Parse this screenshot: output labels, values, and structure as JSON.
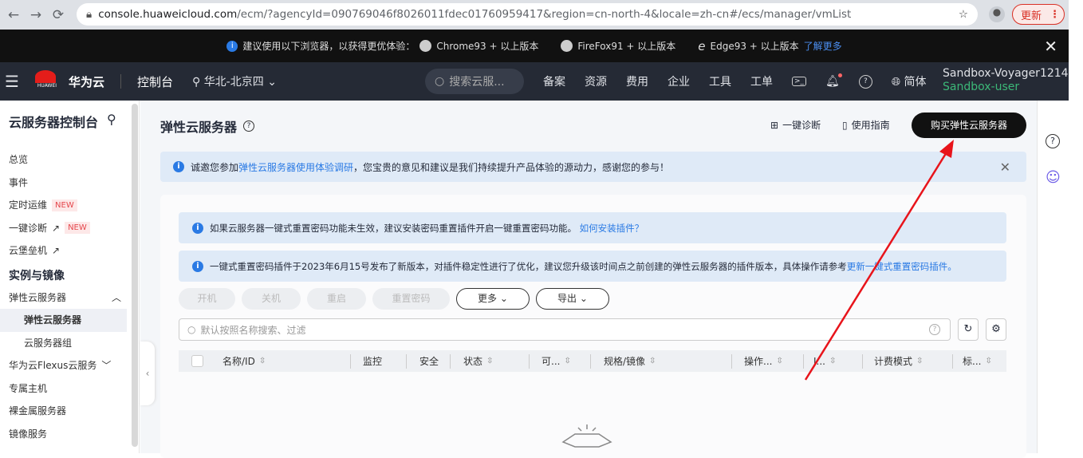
{
  "browser": {
    "url_host": "console.huaweicloud.com",
    "url_rest": "/ecm/?agencyId=090769046f8026011fdec01760959417&region=cn-north-4&locale=zh-cn#/ecs/manager/vmList",
    "update": "更新"
  },
  "banner": {
    "text": "建议使用以下浏览器，以获得更优体验：",
    "chrome": "Chrome93 + 以上版本",
    "firefox": "FireFox91 + 以上版本",
    "edge": "Edge93 + 以上版本",
    "more": "了解更多"
  },
  "topbar": {
    "brand": "华为云",
    "logo_text": "HUAWEI",
    "console": "控制台",
    "region": "华北-北京四",
    "search": "搜索云服...",
    "nav": [
      "备案",
      "资源",
      "费用",
      "企业",
      "工具",
      "工单"
    ],
    "lang": "简体",
    "account": "Sandbox-Voyager1214",
    "user": "Sandbox-user"
  },
  "sidebar": {
    "title": "云服务器控制台",
    "items": [
      "总览",
      "事件",
      "定时运维",
      "一键诊断",
      "云堡垒机"
    ],
    "new_badge": "NEW",
    "section": "实例与镜像",
    "group": "弹性云服务器",
    "sub": [
      "弹性云服务器",
      "云服务器组"
    ],
    "more": [
      "华为云Flexus云服务",
      "专属主机",
      "裸金属服务器",
      "镜像服务"
    ]
  },
  "main": {
    "title": "弹性云服务器",
    "diagnose": "一键诊断",
    "guide": "使用指南",
    "buy": "购买弹性云服务器",
    "notice_pre": "诚邀您参加",
    "notice_link": "弹性云服务器使用体验调研",
    "notice_post": "，您宝贵的意见和建议是我们持续提升产品体验的源动力，感谢您的参与！",
    "tip1": "如果云服务器一键式重置密码功能未生效，建议安装密码重置插件开启一键重置密码功能。",
    "tip1_link": "如何安装插件？",
    "tip2": "一键式重置密码插件于2023年6月15号发布了新版本，对插件稳定性进行了优化，建议您升级该时间点之前创建的弹性云服务器的插件版本，具体操作请参考",
    "tip2_link": "更新一键式重置密码插件。",
    "buttons": [
      "开机",
      "关机",
      "重启",
      "重置密码"
    ],
    "more": "更多",
    "export": "导出",
    "filter_placeholder": "默认按照名称搜索、过滤",
    "columns": [
      "名称/ID",
      "监控",
      "安全",
      "状态",
      "可...",
      "规格/镜像",
      "操作...",
      "I...",
      "计费模式",
      "标..."
    ]
  }
}
